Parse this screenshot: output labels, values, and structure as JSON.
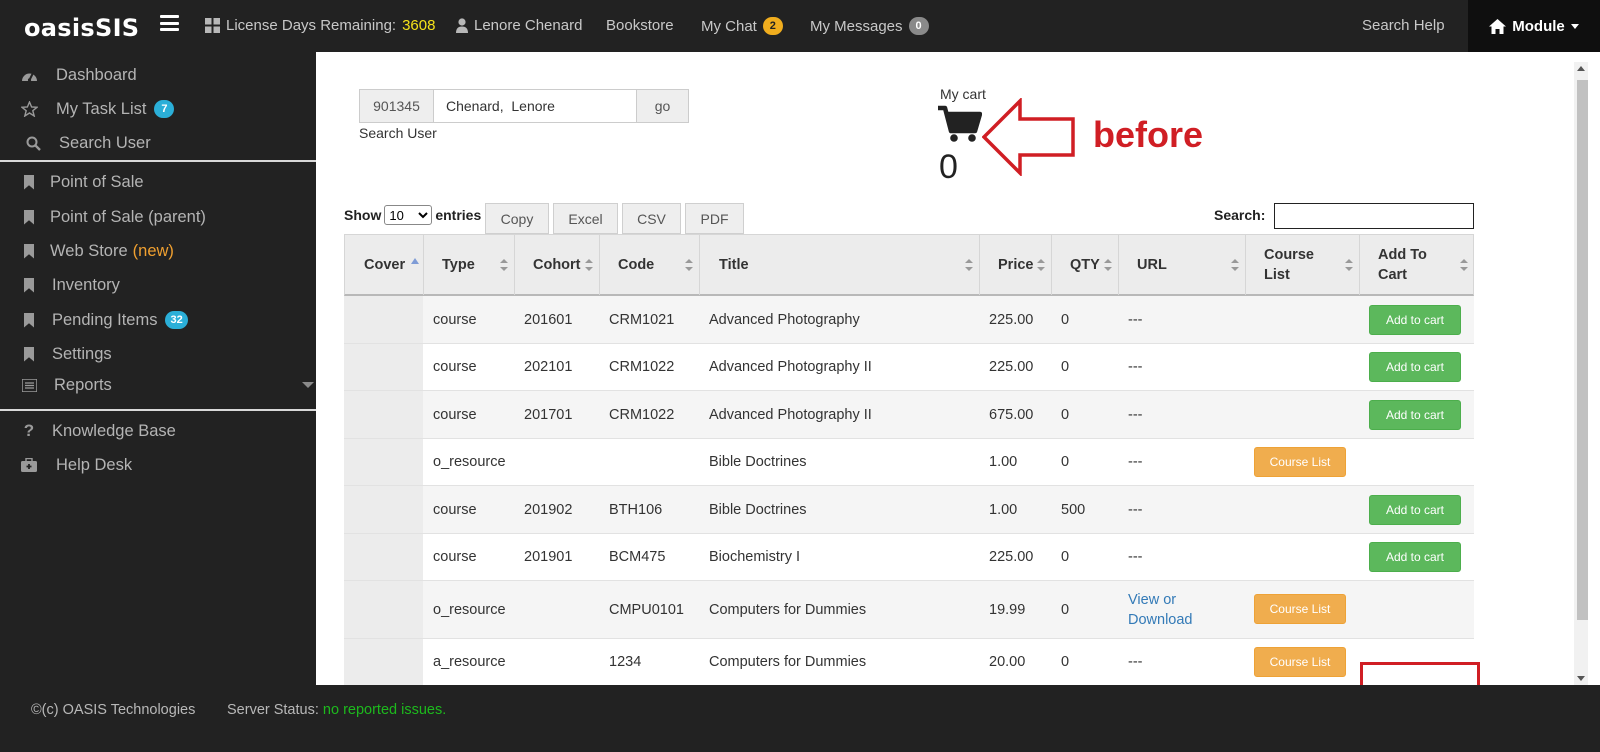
{
  "topbar": {
    "brand": "oasisSIS",
    "license_label": "License Days Remaining:",
    "license_days": "3608",
    "user_name": "Lenore Chenard",
    "bookstore": "Bookstore",
    "my_chat": "My Chat",
    "my_chat_count": "2",
    "my_messages": "My Messages",
    "my_messages_count": "0",
    "search_help": "Search Help",
    "module": "Module"
  },
  "sidebar": {
    "dashboard": "Dashboard",
    "my_task_list": "My Task List",
    "my_task_count": "7",
    "search_user": "Search User",
    "point_of_sale": "Point of Sale",
    "point_of_sale_parent": "Point of Sale (parent)",
    "web_store": "Web Store",
    "web_store_new": "(new)",
    "inventory": "Inventory",
    "pending_items": "Pending Items",
    "pending_count": "32",
    "settings": "Settings",
    "reports": "Reports",
    "knowledge_base": "Knowledge Base",
    "help_desk": "Help Desk"
  },
  "user_search": {
    "id": "901345",
    "name": "Chenard,  Lenore",
    "go": "go",
    "label": "Search User"
  },
  "cart": {
    "label": "My cart",
    "count": "0",
    "annotation": "before"
  },
  "table_controls": {
    "show": "Show",
    "entries_value": "10",
    "entries": "entries",
    "copy": "Copy",
    "excel": "Excel",
    "csv": "CSV",
    "pdf": "PDF",
    "search_label": "Search:",
    "search_value": ""
  },
  "table": {
    "headers": [
      "Cover",
      "Type",
      "Cohort",
      "Code",
      "Title",
      "Price",
      "QTY",
      "URL",
      "Course List",
      "Add To Cart"
    ],
    "add_to_cart_label": "Add to cart",
    "course_list_label": "Course List",
    "rows": [
      {
        "type": "course",
        "cohort": "201601",
        "code": "CRM1021",
        "title": "Advanced Photography",
        "price": "225.00",
        "qty": "0",
        "url": "---"
      },
      {
        "type": "course",
        "cohort": "202101",
        "code": "CRM1022",
        "title": "Advanced Photography II",
        "price": "225.00",
        "qty": "0",
        "url": "---"
      },
      {
        "type": "course",
        "cohort": "201701",
        "code": "CRM1022",
        "title": "Advanced Photography II",
        "price": "675.00",
        "qty": "0",
        "url": "---"
      },
      {
        "type": "o_resource",
        "cohort": "",
        "code": "",
        "title": "Bible Doctrines",
        "price": "1.00",
        "qty": "0",
        "url": "---"
      },
      {
        "type": "course",
        "cohort": "201902",
        "code": "BTH106",
        "title": "Bible Doctrines",
        "price": "1.00",
        "qty": "500",
        "url": "---"
      },
      {
        "type": "course",
        "cohort": "201901",
        "code": "BCM475",
        "title": "Biochemistry I",
        "price": "225.00",
        "qty": "0",
        "url": "---"
      },
      {
        "type": "o_resource",
        "cohort": "",
        "code": "CMPU0101",
        "title": "Computers for Dummies",
        "price": "19.99",
        "qty": "0",
        "url_line1": "View or",
        "url_line2": "Download"
      },
      {
        "type": "a_resource",
        "cohort": "",
        "code": "1234",
        "title": "Computers for Dummies",
        "price": "20.00",
        "qty": "0",
        "url": "---"
      }
    ]
  },
  "footer": {
    "copyright": "©(c) OASIS Technologies",
    "server_status_label": "Server Status:",
    "server_status_value": "no reported issues."
  },
  "colors": {
    "nav_bg": "#222222",
    "add_button": "#5cb85c",
    "course_list_button": "#f0ad4e",
    "annotation_red": "#d01e24",
    "status_ok": "#1db91d",
    "license_highlight": "#f5e21a"
  }
}
